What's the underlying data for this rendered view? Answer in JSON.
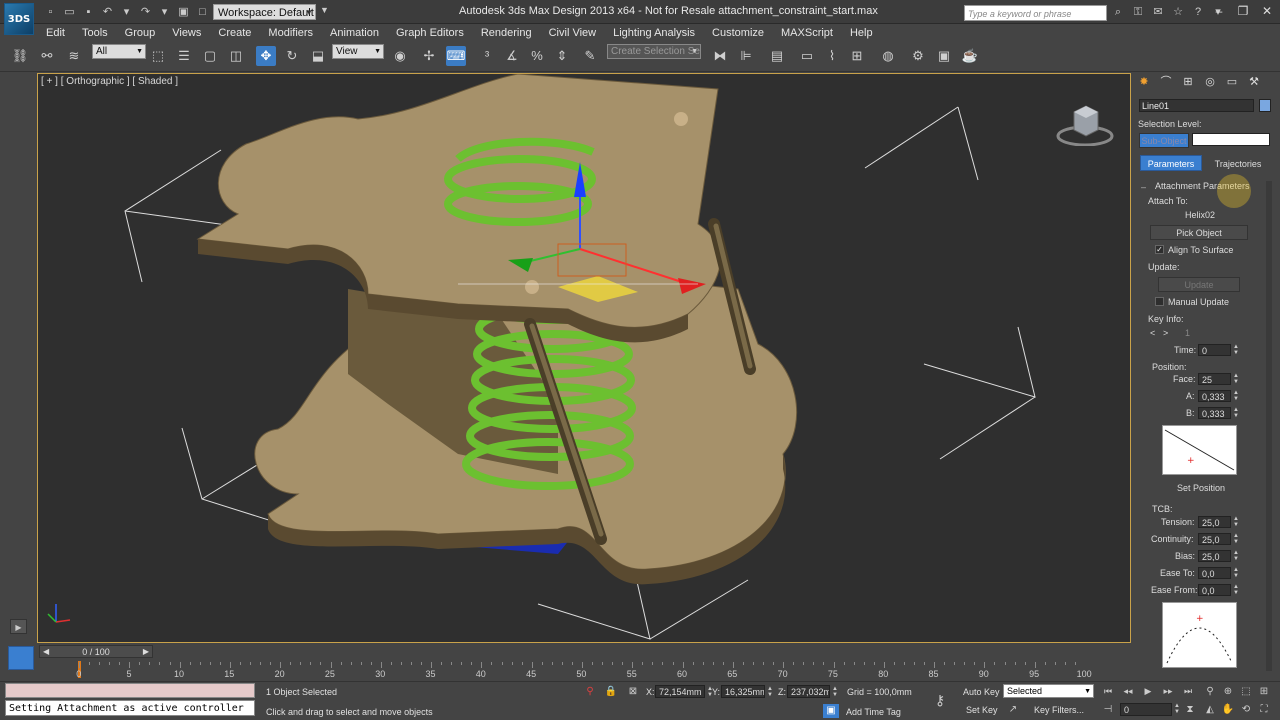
{
  "titlebar": {
    "app_logo": "3DS",
    "workspace_label": "Workspace: Default",
    "window_title": "Autodesk 3ds Max Design 2013 x64    -  Not for Resale    attachment_constraint_start.max",
    "search_placeholder": "Type a keyword or phrase"
  },
  "menu": [
    "Edit",
    "Tools",
    "Group",
    "Views",
    "Create",
    "Modifiers",
    "Animation",
    "Graph Editors",
    "Rendering",
    "Civil View",
    "Lighting Analysis",
    "Customize",
    "MAXScript",
    "Help"
  ],
  "toolbar": {
    "selection_filter": "All",
    "reference_coord": "View",
    "named_selection": "Create Selection Se"
  },
  "viewport": {
    "label": "[ + ] [ Orthographic ] [ Shaded ]"
  },
  "command_panel": {
    "object_name": "Line01",
    "selection_level_label": "Selection Level:",
    "sub_object_label": "Sub-Object",
    "tab_parameters": "Parameters",
    "tab_trajectories": "Trajectories",
    "rollout_title": "Attachment Parameters",
    "attach_to_label": "Attach To:",
    "attach_target": "Helix02",
    "pick_object": "Pick Object",
    "align_to_surface": "Align To Surface",
    "align_checked": true,
    "update_label": "Update:",
    "update_button": "Update",
    "manual_update": "Manual Update",
    "manual_checked": false,
    "key_info_label": "Key Info:",
    "key_number": "1",
    "time_label": "Time:",
    "time_value": "0",
    "position_label": "Position:",
    "face_label": "Face:",
    "face_value": "25",
    "a_label": "A:",
    "a_value": "0,333",
    "b_label": "B:",
    "b_value": "0,333",
    "set_position": "Set Position",
    "tcb_label": "TCB:",
    "tension_label": "Tension:",
    "tension_value": "25,0",
    "continuity_label": "Continuity:",
    "continuity_value": "25,0",
    "bias_label": "Bias:",
    "bias_value": "25,0",
    "ease_to_label": "Ease To:",
    "ease_to_value": "0,0",
    "ease_from_label": "Ease From:",
    "ease_from_value": "0,0"
  },
  "timeline": {
    "slider_label": "0 / 100",
    "ticks": [
      "0",
      "5",
      "10",
      "15",
      "20",
      "25",
      "30",
      "35",
      "40",
      "45",
      "50",
      "55",
      "60",
      "65",
      "70",
      "75",
      "80",
      "85",
      "90",
      "95",
      "100"
    ]
  },
  "status": {
    "maxscript_output": "Setting Attachment as active controller",
    "selection_info": "1 Object Selected",
    "prompt": "Click and drag to select and move objects",
    "x_label": "X:",
    "x_value": "72,154mm",
    "y_label": "Y:",
    "y_value": "16,325mm",
    "z_label": "Z:",
    "z_value": "237,032mm",
    "grid": "Grid = 100,0mm",
    "add_time_tag": "Add Time Tag",
    "auto_key": "Auto Key",
    "key_mode": "Selected",
    "set_key": "Set Key",
    "key_filters": "Key Filters...",
    "current_frame": "0"
  },
  "colors": {
    "spring": "#6cc030",
    "plate": "#a6916a",
    "base": "#1a2cb0",
    "accent": "#3a7fd0",
    "viewport_border": "#c9a24a"
  }
}
